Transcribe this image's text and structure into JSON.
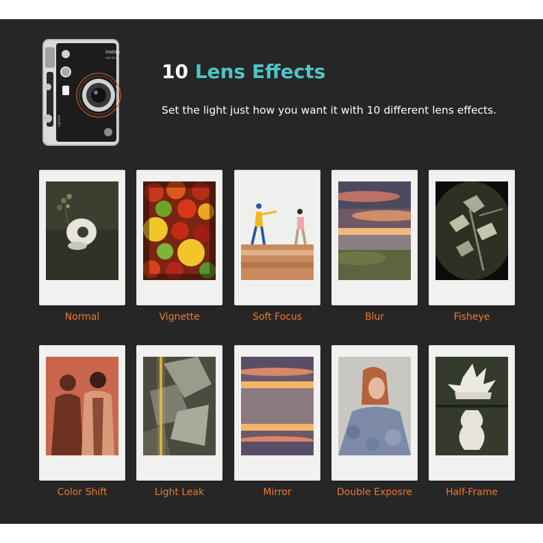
{
  "header": {
    "title_number": "10",
    "title_text": "Lens Effects",
    "subtitle": "Set the light just how you want it with 10 different lens effects."
  },
  "camera": {
    "brand_label": "instax",
    "model_label": "mini Evo",
    "maker_label": "FUJIFILM"
  },
  "colors": {
    "panel_background": "#262626",
    "title_accent": "#4fc5c4",
    "caption": "#f07a2c",
    "text": "#ffffff"
  },
  "effects": [
    {
      "label": "Normal"
    },
    {
      "label": "Vignette"
    },
    {
      "label": "Soft Focus"
    },
    {
      "label": "Blur"
    },
    {
      "label": "Fisheye"
    },
    {
      "label": "Color Shift"
    },
    {
      "label": "Light Leak"
    },
    {
      "label": "Mirror"
    },
    {
      "label": "Double Exposre"
    },
    {
      "label": "Half-Frame"
    }
  ]
}
